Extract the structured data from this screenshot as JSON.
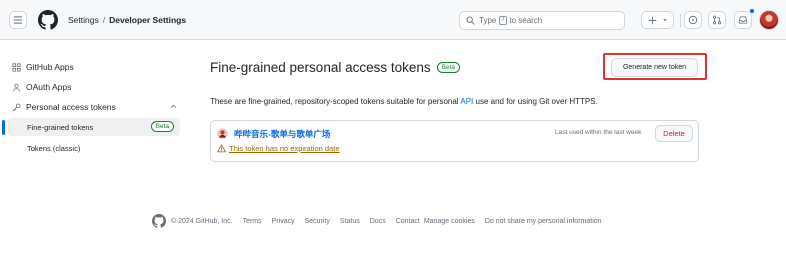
{
  "header": {
    "breadcrumb": {
      "parent": "Settings",
      "separator": "/",
      "current": "Developer Settings"
    },
    "search": {
      "prefix": "Type",
      "key": "/",
      "suffix": "to search"
    },
    "icons": [
      "menu-icon",
      "github-logo",
      "search-icon",
      "plus-icon",
      "caret-down-icon",
      "issue-icon",
      "pull-request-icon",
      "inbox-icon",
      "avatar"
    ]
  },
  "sidebar": {
    "items": [
      {
        "label": "GitHub Apps",
        "icon": "apps-icon"
      },
      {
        "label": "OAuth Apps",
        "icon": "person-icon"
      },
      {
        "label": "Personal access tokens",
        "icon": "key-icon"
      }
    ],
    "subitems": [
      {
        "label": "Fine-grained tokens",
        "badge": "Beta",
        "active": true
      },
      {
        "label": "Tokens (classic)"
      }
    ]
  },
  "main": {
    "title": "Fine-grained personal access tokens",
    "title_badge": "Beta",
    "generate_button": "Generate new token",
    "description_before": "These are fine-grained, repository-scoped tokens suitable for personal",
    "description_link": "API",
    "description_after": "use and for using Git over HTTPS.",
    "token": {
      "name": "哔哔音乐-歌单与歌单广场",
      "last_used": "Last used within the last week",
      "delete_button": "Delete",
      "warning": "This token has no expiration date"
    }
  },
  "footer": {
    "copyright": "© 2024 GitHub, Inc.",
    "links": [
      "Terms",
      "Privacy",
      "Security",
      "Status",
      "Docs",
      "Contact",
      "Manage cookies",
      "Do not share my personal information"
    ]
  },
  "colors": {
    "accent": "#0969da",
    "danger": "#cf222e",
    "success": "#1a7f37",
    "warning": "#9a6700",
    "highlight_box": "#e03131"
  }
}
